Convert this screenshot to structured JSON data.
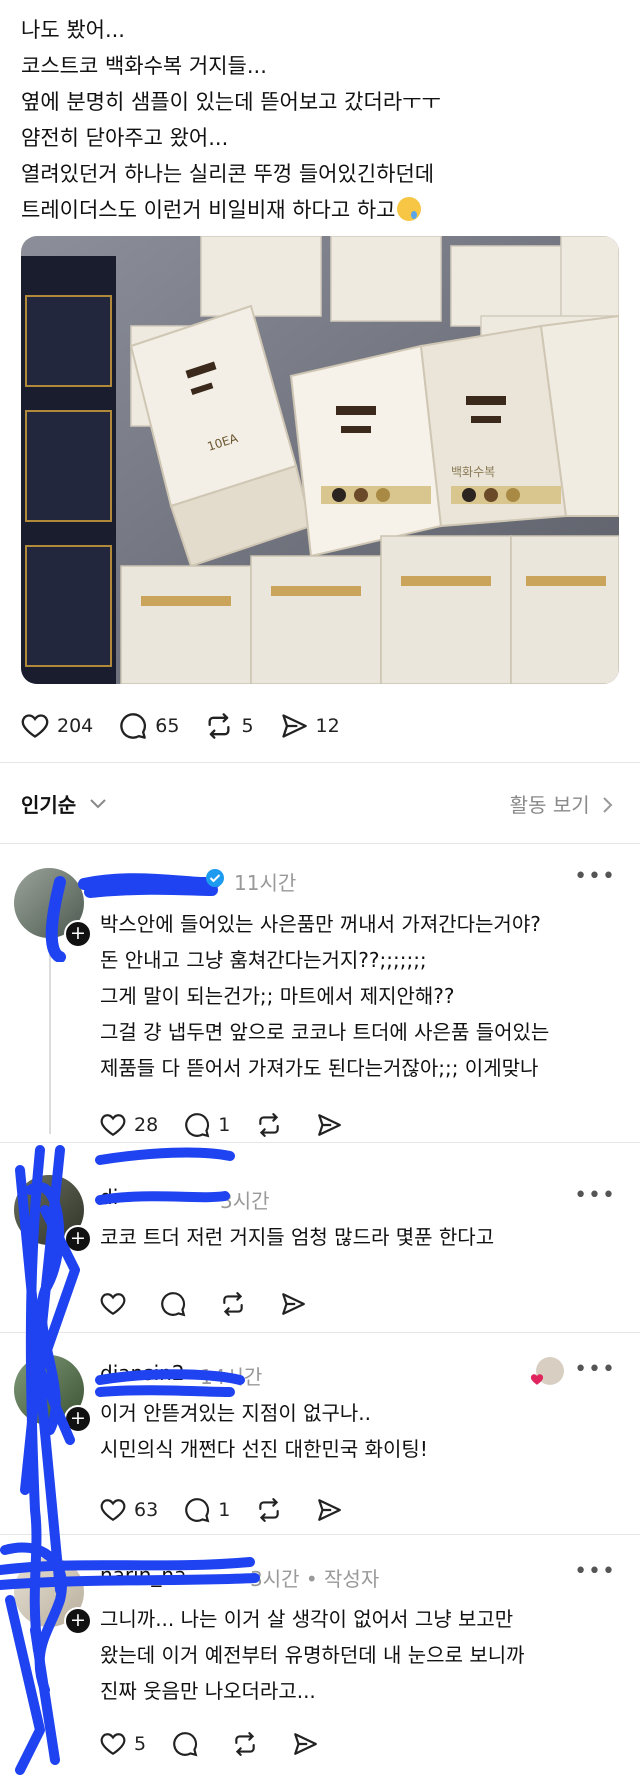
{
  "post": {
    "lines": [
      "나도 봤어...",
      "코스트코 백화수복 거지들...",
      "옆에 분명히 샘플이 있는데 뜯어보고 갔더라ㅜㅜ",
      "얌전히 닫아주고 왔어...",
      "열려있던거 하나는 실리콘 뚜껑 들어있긴하던데",
      "트레이더스도 이런거 비일비재 하다고 하고"
    ],
    "photo_box_text": "10EA",
    "photo_box_brand": "백화수복",
    "actions": {
      "likes": "204",
      "comments": "65",
      "reposts": "5",
      "shares": "12"
    }
  },
  "sort": {
    "label": "인기순",
    "activity_link": "활동 보기"
  },
  "comments": [
    {
      "time": "11시간",
      "lines": [
        "박스안에 들어있는 사은품만 꺼내서 가져간다는거야?",
        "돈 안내고 그냥 훔쳐간다는거지??;;;;;;;",
        "그게 말이 되는건가;; 마트에서 제지안해??",
        "그걸 걍 냅두면 앞으로 코코나 트더에 사은품 들어있는",
        "제품들 다 뜯어서 가져가도 된다는거잖아;;; 이게맞나"
      ],
      "likes": "28",
      "replies": "1"
    },
    {
      "username": "di",
      "time": "3시간",
      "lines": [
        "코코 트더 저런 거지들 엄청 많드라 몇푼 한다고"
      ],
      "likes": "",
      "replies": ""
    },
    {
      "username": "diansin2",
      "time": "14시간",
      "lines": [
        "이거 안뜯겨있는 지점이 없구나..",
        "시민의식 개쩐다 선진 대한민국 화이팅!"
      ],
      "likes": "63",
      "replies": "1"
    },
    {
      "username": "narin_na",
      "time": "3시간 • 작성자",
      "lines": [
        "그니까... 나는 이거 살 생각이 없어서 그냥 보고만",
        "왔는데 이거 예전부터 유명하던데 내 눈으로 보니까",
        "진짜 웃음만 나오더라고..."
      ],
      "likes": "5",
      "replies": ""
    }
  ],
  "colors": {
    "scribble": "#1f43f0",
    "verified": "#1d9bf0",
    "heart_red": "#e0245e"
  }
}
